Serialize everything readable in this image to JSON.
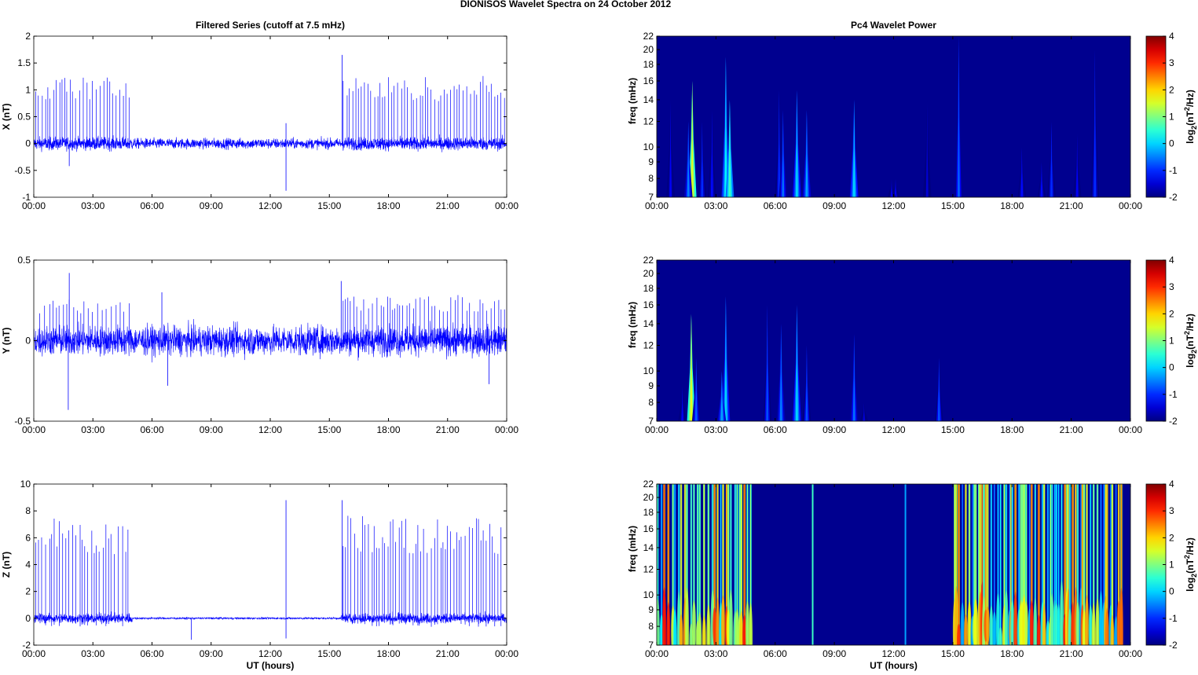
{
  "title": "DIONISOS Wavelet Spectra on 24 October   2012",
  "chart_data": [
    {
      "type": "line",
      "title": "Filtered Series (cutoff at 7.5 mHz)",
      "ylabel": "X (nT)",
      "xlabel": "",
      "ylim": [
        -1,
        2
      ],
      "yticks": [
        "-1",
        "-0.5",
        "0",
        "0.5",
        "1",
        "1.5",
        "2"
      ],
      "ytick_values": [
        -1,
        -0.5,
        0,
        0.5,
        1,
        1.5,
        2
      ],
      "xticks": [
        "00:00",
        "03:00",
        "06:00",
        "09:00",
        "12:00",
        "15:00",
        "18:00",
        "21:00",
        "00:00"
      ],
      "xlim_hours": [
        0,
        24
      ],
      "color": "#0000ff",
      "noise_amplitude": 0.06,
      "spike_groups": [
        {
          "start": 0.1,
          "end": 4.9,
          "interval": 0.16,
          "amp": 1.05
        },
        {
          "start": 15.7,
          "end": 23.9,
          "interval": 0.15,
          "amp": 1.05
        }
      ],
      "isolated_spikes": [
        {
          "t": 15.65,
          "v": 1.65
        },
        {
          "t": 12.8,
          "v": 0.38
        },
        {
          "t": 12.8,
          "v": -0.88
        },
        {
          "t": 1.8,
          "v": -0.42
        }
      ]
    },
    {
      "type": "line",
      "title": "",
      "ylabel": "Y (nT)",
      "xlabel": "",
      "ylim": [
        -0.5,
        0.5
      ],
      "yticks": [
        "-0.5",
        "0",
        "0.5"
      ],
      "ytick_values": [
        -0.5,
        0,
        0.5
      ],
      "xticks": [
        "00:00",
        "03:00",
        "06:00",
        "09:00",
        "12:00",
        "15:00",
        "18:00",
        "21:00",
        "00:00"
      ],
      "xlim_hours": [
        0,
        24
      ],
      "color": "#0000ff",
      "noise_amplitude": 0.045,
      "spike_groups": [
        {
          "start": 0.3,
          "end": 4.9,
          "interval": 0.2,
          "amp": 0.22
        },
        {
          "start": 15.7,
          "end": 23.9,
          "interval": 0.18,
          "amp": 0.24
        }
      ],
      "isolated_spikes": [
        {
          "t": 1.8,
          "v": 0.42
        },
        {
          "t": 1.75,
          "v": -0.43
        },
        {
          "t": 6.5,
          "v": 0.3
        },
        {
          "t": 15.6,
          "v": 0.37
        },
        {
          "t": 23.1,
          "v": -0.27
        },
        {
          "t": 6.8,
          "v": -0.28
        }
      ]
    },
    {
      "type": "line",
      "title": "",
      "ylabel": "Z (nT)",
      "xlabel": "UT (hours)",
      "ylim": [
        -2,
        10
      ],
      "yticks": [
        "-2",
        "0",
        "2",
        "4",
        "6",
        "8",
        "10"
      ],
      "ytick_values": [
        -2,
        0,
        2,
        4,
        6,
        8,
        10
      ],
      "xticks": [
        "00:00",
        "03:00",
        "06:00",
        "09:00",
        "12:00",
        "15:00",
        "18:00",
        "21:00",
        "00:00"
      ],
      "xlim_hours": [
        0,
        24
      ],
      "color": "#0000ff",
      "noise_amplitude": 0.18,
      "spike_groups": [
        {
          "start": 0.1,
          "end": 4.9,
          "interval": 0.16,
          "amp": 6.2
        },
        {
          "start": 15.7,
          "end": 23.9,
          "interval": 0.15,
          "amp": 6.4
        }
      ],
      "isolated_spikes": [
        {
          "t": 12.8,
          "v": 8.8
        },
        {
          "t": 15.65,
          "v": 8.8
        },
        {
          "t": 12.8,
          "v": -1.5
        },
        {
          "t": 8.0,
          "v": -1.6
        }
      ]
    },
    {
      "type": "heatmap",
      "title": "Pc4 Wavelet Power",
      "ylabel": "freq (mHz)",
      "xlabel": "",
      "ylim": [
        7,
        22
      ],
      "yscale": "log",
      "yticks": [
        "7",
        "8",
        "9",
        "10",
        "12",
        "14",
        "16",
        "18",
        "20",
        "22"
      ],
      "ytick_values": [
        7,
        8,
        9,
        10,
        12,
        14,
        16,
        18,
        20,
        22
      ],
      "xticks": [
        "00:00",
        "03:00",
        "06:00",
        "09:00",
        "12:00",
        "15:00",
        "18:00",
        "21:00",
        "00:00"
      ],
      "xlim_hours": [
        0,
        24
      ],
      "colorbar": {
        "label": "log2(nT2/Hz)",
        "range": [
          -2,
          4
        ],
        "ticks": [
          "-2",
          "-1",
          "0",
          "1",
          "2",
          "3",
          "4"
        ]
      },
      "background_value": -2,
      "events": [
        {
          "t": 1.8,
          "f": 16,
          "v": 1.6
        },
        {
          "t": 1.6,
          "f": 12,
          "v": -0.5
        },
        {
          "t": 3.5,
          "f": 19,
          "v": 0.2
        },
        {
          "t": 3.7,
          "f": 14,
          "v": 0.6
        },
        {
          "t": 2.3,
          "f": 12,
          "v": -1
        },
        {
          "t": 2.8,
          "f": 13,
          "v": -1.2
        },
        {
          "t": 6.2,
          "f": 15,
          "v": -1
        },
        {
          "t": 6.4,
          "f": 13,
          "v": -0.6
        },
        {
          "t": 7.1,
          "f": 15,
          "v": 0
        },
        {
          "t": 7.6,
          "f": 13,
          "v": -0.3
        },
        {
          "t": 10,
          "f": 14,
          "v": 0
        },
        {
          "t": 15.3,
          "f": 22,
          "v": -0.7
        },
        {
          "t": 20,
          "f": 12,
          "v": -1
        },
        {
          "t": 18.5,
          "f": 10,
          "v": -1.2
        },
        {
          "t": 19.5,
          "f": 9,
          "v": -1.2
        },
        {
          "t": 22.2,
          "f": 20,
          "v": -1
        },
        {
          "t": 12.1,
          "f": 8,
          "v": -1.3
        },
        {
          "t": 11.9,
          "f": 8,
          "v": -1.4
        },
        {
          "t": 13.7,
          "f": 14,
          "v": -1.5
        },
        {
          "t": 21.3,
          "f": 11,
          "v": -1.3
        },
        {
          "t": 0.7,
          "f": 14,
          "v": -1.3
        }
      ]
    },
    {
      "type": "heatmap",
      "title": "",
      "ylabel": "freq (mHz)",
      "xlabel": "",
      "ylim": [
        7,
        22
      ],
      "yscale": "log",
      "yticks": [
        "7",
        "8",
        "9",
        "10",
        "12",
        "14",
        "16",
        "18",
        "20",
        "22"
      ],
      "ytick_values": [
        7,
        8,
        9,
        10,
        12,
        14,
        16,
        18,
        20,
        22
      ],
      "xticks": [
        "00:00",
        "03:00",
        "06:00",
        "09:00",
        "12:00",
        "15:00",
        "18:00",
        "21:00",
        "00:00"
      ],
      "xlim_hours": [
        0,
        24
      ],
      "colorbar": {
        "label": "log2(nT2/Hz)",
        "range": [
          -2,
          4
        ],
        "ticks": [
          "-2",
          "-1",
          "0",
          "1",
          "2",
          "3",
          "4"
        ]
      },
      "background_value": -2,
      "events": [
        {
          "t": 1.75,
          "f": 15,
          "v": 1.6
        },
        {
          "t": 3.5,
          "f": 17,
          "v": 0
        },
        {
          "t": 3.3,
          "f": 10,
          "v": -0.3
        },
        {
          "t": 5.6,
          "f": 16,
          "v": -0.8
        },
        {
          "t": 6.3,
          "f": 14,
          "v": -0.5
        },
        {
          "t": 7.1,
          "f": 16,
          "v": 0
        },
        {
          "t": 7.6,
          "f": 12,
          "v": -0.8
        },
        {
          "t": 10,
          "f": 13,
          "v": -0.6
        },
        {
          "t": 14.3,
          "f": 11,
          "v": -0.8
        },
        {
          "t": 1.3,
          "f": 9,
          "v": -1.3
        },
        {
          "t": 10.5,
          "f": 8,
          "v": -1.5
        },
        {
          "t": 2.0,
          "f": 11,
          "v": -0.7
        }
      ]
    },
    {
      "type": "heatmap",
      "title": "",
      "ylabel": "freq (mHz)",
      "xlabel": "UT (hours)",
      "ylim": [
        7,
        22
      ],
      "yscale": "log",
      "yticks": [
        "7",
        "8",
        "9",
        "10",
        "12",
        "14",
        "16",
        "18",
        "20",
        "22"
      ],
      "ytick_values": [
        7,
        8,
        9,
        10,
        12,
        14,
        16,
        18,
        20,
        22
      ],
      "xticks": [
        "00:00",
        "03:00",
        "06:00",
        "09:00",
        "12:00",
        "15:00",
        "18:00",
        "21:00",
        "00:00"
      ],
      "xlim_hours": [
        0,
        24
      ],
      "colorbar": {
        "label": "log2(nT2/Hz)",
        "range": [
          -2,
          4
        ],
        "ticks": [
          "-2",
          "-1",
          "0",
          "1",
          "2",
          "3",
          "4"
        ]
      },
      "background_value": -2,
      "dense_regions": [
        {
          "start": 0.05,
          "end": 4.8,
          "interval": 0.16
        },
        {
          "start": 15.1,
          "end": 23.6,
          "interval": 0.13
        }
      ],
      "events": [
        {
          "t": 7.9,
          "f": 22,
          "v": 0.6
        },
        {
          "t": 12.6,
          "f": 22,
          "v": -0.3
        }
      ]
    }
  ]
}
